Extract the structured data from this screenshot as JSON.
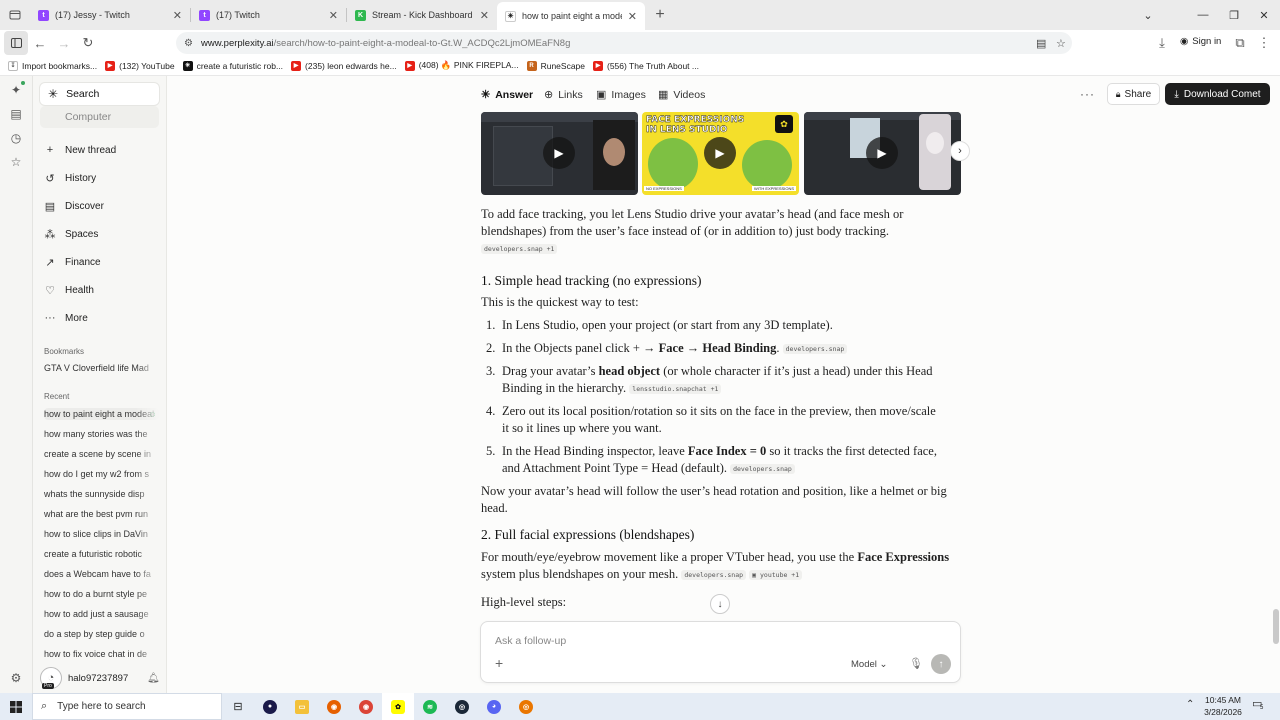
{
  "tabs": [
    {
      "title": "(17) Jessy - Twitch",
      "fav_color": "#9146ff",
      "fav_glyph": "t"
    },
    {
      "title": "(17) Twitch",
      "fav_color": "#9146ff",
      "fav_glyph": "t"
    },
    {
      "title": "Stream - Kick Dashboard",
      "fav_color": "#2fb84f",
      "fav_glyph": "K"
    },
    {
      "title": "how to paint eight a modeal to",
      "fav_color": "#1a1a1a",
      "fav_glyph": "✳"
    }
  ],
  "address": {
    "domain": "www.perplexity.ai",
    "path": "/search/how-to-paint-eight-a-modeal-to-Gt.W_ACDQc2LjmOMEaFN8g"
  },
  "signin_label": "Sign in",
  "bookmarks": [
    {
      "label": "Import bookmarks...",
      "color": "#777",
      "glyph": "↧"
    },
    {
      "label": "(132) YouTube",
      "color": "#e62117",
      "glyph": "▶"
    },
    {
      "label": "create a futuristic rob...",
      "color": "#111",
      "glyph": "✳"
    },
    {
      "label": "(235) leon edwards he...",
      "color": "#e62117",
      "glyph": "▶"
    },
    {
      "label": "(408) 🔥 PINK FIREPLA...",
      "color": "#e62117",
      "glyph": "▶"
    },
    {
      "label": "RuneScape",
      "color": "#c5641c",
      "glyph": "R"
    },
    {
      "label": "(556) The Truth About ...",
      "color": "#e62117",
      "glyph": "▶"
    }
  ],
  "sidebar": {
    "search_label": "Search",
    "computer_label": "Computer",
    "items": [
      {
        "label": "New thread",
        "icon": "+"
      },
      {
        "label": "History",
        "icon": "↺"
      },
      {
        "label": "Discover",
        "icon": "▤"
      },
      {
        "label": "Spaces",
        "icon": "⁂"
      },
      {
        "label": "Finance",
        "icon": "↗"
      },
      {
        "label": "Health",
        "icon": "♡"
      },
      {
        "label": "More",
        "icon": "···"
      }
    ],
    "bookmarks_heading": "Bookmarks",
    "bookmark_items": [
      "GTA V Cloverfield life Mad"
    ],
    "recent_heading": "Recent",
    "recent": [
      "how to paint eight a modeal",
      "how many stories was the",
      "create a scene by scene in",
      "how do I get my w2 from s",
      "whats the sunnyside disp",
      "what are the best pvm run",
      "how to slice clips in DaVin",
      "create a futuristic robotic",
      "does a Webcam have to fa",
      "how to do a burnt style pe",
      "how to add just a sausage",
      "do a step by step guide o",
      "how to fix voice chat in de"
    ],
    "username": "halo97237897",
    "badge": "Pro"
  },
  "topbar": {
    "tabs": [
      {
        "label": "Answer",
        "icon": "✳"
      },
      {
        "label": "Links",
        "icon": "⊕"
      },
      {
        "label": "Images",
        "icon": "▣"
      },
      {
        "label": "Videos",
        "icon": "▦"
      }
    ],
    "share_label": "Share",
    "download_label": "Download Comet"
  },
  "videos": {
    "thumb2_line1": "FACE EXPRESSIONS",
    "thumb2_line2": "IN LENS STUDIO",
    "thumb2_tag_left": "NO EXPRESSIONS",
    "thumb2_tag_right": "WITH EXPRESSIONS"
  },
  "article": {
    "intro1": "To add face tracking, you let Lens Studio drive your avatar’s head (and face mesh or",
    "intro2": "blendshapes) from the user’s face instead of (or in addition to) just body tracking.",
    "intro_cite": "developers.snap +1",
    "h1": "1. Simple head tracking (no expressions)",
    "h1_sub": "This is the quickest way to test:",
    "steps": [
      {
        "num": "1.",
        "line1": "In Lens Studio, open your project (or start from any 3D template).",
        "line2": "",
        "cite": ""
      },
      {
        "num": "2.",
        "line1_a": "In the Objects panel click + → ",
        "bold1": "Face → Head Binding",
        "line1_b": ".",
        "cite": "developers.snap"
      },
      {
        "num": "3.",
        "line1_a": "Drag your avatar’s ",
        "bold1": "head object",
        "line1_b": " (or whole character if it’s just a head) under this Head",
        "line2": "Binding in the hierarchy.",
        "cite": "lensstudio.snapchat +1"
      },
      {
        "num": "4.",
        "line1": "Zero out its local position/rotation so it sits on the face in the preview, then move/scale",
        "line2": "it so it lines up where you want.",
        "cite": ""
      },
      {
        "num": "5.",
        "line1_a": "In the Head Binding inspector, leave ",
        "bold1": "Face Index = 0",
        "line1_b": " so it tracks the first detected face,",
        "line2": "and Attachment Point Type = Head (default).",
        "cite": "developers.snap"
      }
    ],
    "after1": "Now your avatar’s head will follow the user’s head rotation and position, like a helmet or big",
    "after2": "head.",
    "h2": "2. Full facial expressions (blendshapes)",
    "p2_a": "For mouth/eye/eyebrow movement like a proper VTuber head, you use the ",
    "p2_bold": "Face Expressions",
    "p2_line2": "system plus blendshapes on your mesh.",
    "p2_cite1": "developers.snap",
    "p2_cite2": "youtube +1",
    "highlevel": "High-level steps:"
  },
  "composer": {
    "placeholder": "Ask a follow-up",
    "model_label": "Model"
  },
  "taskbar": {
    "search_placeholder": "Type here to search",
    "time": "10:45 AM",
    "date": "3/28/2026",
    "notif_count": "5"
  },
  "colors": {
    "accent_dark": "#1e1e1e",
    "twitch": "#9146ff",
    "kick": "#2fb84f",
    "youtube": "#e62117"
  }
}
